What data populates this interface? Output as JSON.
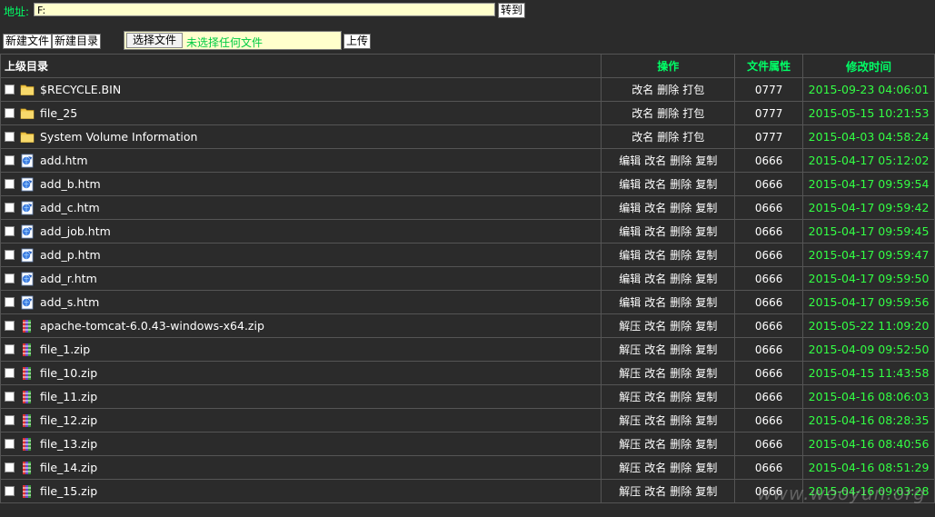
{
  "toolbar": {
    "address_label": "地址:",
    "address_value": "F:",
    "go_label": "转到",
    "new_file_label": "新建文件",
    "new_dir_label": "新建目录",
    "choose_file_label": "选择文件",
    "no_file_text": "未选择任何文件",
    "upload_label": "上传"
  },
  "table": {
    "headers": {
      "parent": "上级目录",
      "ops": "操作",
      "perm": "文件属性",
      "time": "修改时间"
    },
    "rows": [
      {
        "type": "folder",
        "name": "$RECYCLE.BIN",
        "ops": [
          "改名",
          "删除",
          "打包"
        ],
        "perm": "0777",
        "time": "2015-09-23 04:06:01"
      },
      {
        "type": "folder",
        "name": "file_25",
        "ops": [
          "改名",
          "删除",
          "打包"
        ],
        "perm": "0777",
        "time": "2015-05-15 10:21:53"
      },
      {
        "type": "folder",
        "name": "System Volume Information",
        "ops": [
          "改名",
          "删除",
          "打包"
        ],
        "perm": "0777",
        "time": "2015-04-03 04:58:24"
      },
      {
        "type": "htm",
        "name": "add.htm",
        "ops": [
          "编辑",
          "改名",
          "删除",
          "复制"
        ],
        "perm": "0666",
        "time": "2015-04-17 05:12:02"
      },
      {
        "type": "htm",
        "name": "add_b.htm",
        "ops": [
          "编辑",
          "改名",
          "删除",
          "复制"
        ],
        "perm": "0666",
        "time": "2015-04-17 09:59:54"
      },
      {
        "type": "htm",
        "name": "add_c.htm",
        "ops": [
          "编辑",
          "改名",
          "删除",
          "复制"
        ],
        "perm": "0666",
        "time": "2015-04-17 09:59:42"
      },
      {
        "type": "htm",
        "name": "add_job.htm",
        "ops": [
          "编辑",
          "改名",
          "删除",
          "复制"
        ],
        "perm": "0666",
        "time": "2015-04-17 09:59:45"
      },
      {
        "type": "htm",
        "name": "add_p.htm",
        "ops": [
          "编辑",
          "改名",
          "删除",
          "复制"
        ],
        "perm": "0666",
        "time": "2015-04-17 09:59:47"
      },
      {
        "type": "htm",
        "name": "add_r.htm",
        "ops": [
          "编辑",
          "改名",
          "删除",
          "复制"
        ],
        "perm": "0666",
        "time": "2015-04-17 09:59:50"
      },
      {
        "type": "htm",
        "name": "add_s.htm",
        "ops": [
          "编辑",
          "改名",
          "删除",
          "复制"
        ],
        "perm": "0666",
        "time": "2015-04-17 09:59:56"
      },
      {
        "type": "zip",
        "name": "apache-tomcat-6.0.43-windows-x64.zip",
        "ops": [
          "解压",
          "改名",
          "删除",
          "复制"
        ],
        "perm": "0666",
        "time": "2015-05-22 11:09:20"
      },
      {
        "type": "zip",
        "name": "file_1.zip",
        "ops": [
          "解压",
          "改名",
          "删除",
          "复制"
        ],
        "perm": "0666",
        "time": "2015-04-09 09:52:50"
      },
      {
        "type": "zip",
        "name": "file_10.zip",
        "ops": [
          "解压",
          "改名",
          "删除",
          "复制"
        ],
        "perm": "0666",
        "time": "2015-04-15 11:43:58"
      },
      {
        "type": "zip",
        "name": "file_11.zip",
        "ops": [
          "解压",
          "改名",
          "删除",
          "复制"
        ],
        "perm": "0666",
        "time": "2015-04-16 08:06:03"
      },
      {
        "type": "zip",
        "name": "file_12.zip",
        "ops": [
          "解压",
          "改名",
          "删除",
          "复制"
        ],
        "perm": "0666",
        "time": "2015-04-16 08:28:35"
      },
      {
        "type": "zip",
        "name": "file_13.zip",
        "ops": [
          "解压",
          "改名",
          "删除",
          "复制"
        ],
        "perm": "0666",
        "time": "2015-04-16 08:40:56"
      },
      {
        "type": "zip",
        "name": "file_14.zip",
        "ops": [
          "解压",
          "改名",
          "删除",
          "复制"
        ],
        "perm": "0666",
        "time": "2015-04-16 08:51:29"
      },
      {
        "type": "zip",
        "name": "file_15.zip",
        "ops": [
          "解压",
          "改名",
          "删除",
          "复制"
        ],
        "perm": "0666",
        "time": "2015-04-16 09:03:28"
      }
    ]
  },
  "icons": {
    "folder": "folder-icon",
    "htm": "web-page-icon",
    "zip": "zip-archive-icon"
  },
  "colors": {
    "background": "#2b2b2b",
    "accent_green": "#00ff66",
    "time_green": "#33ff44",
    "input_bg": "#ffffcc"
  },
  "watermark": "www.wooyun.org"
}
